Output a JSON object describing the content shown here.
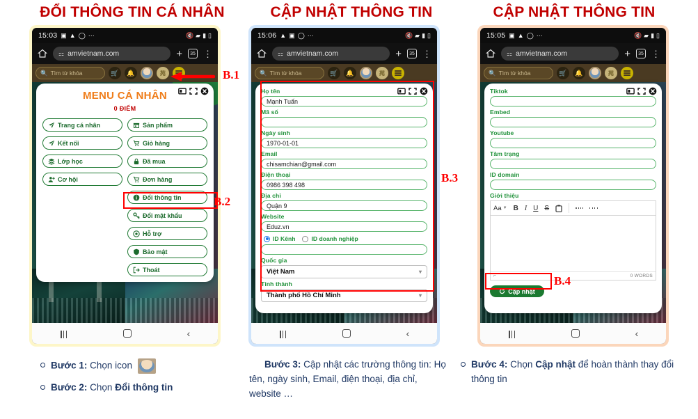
{
  "titles": {
    "col1": "ĐỔI THÔNG TIN CÁ NHÂN",
    "col2": "CẬP NHẬT THÔNG TIN",
    "col3": "CẬP NHẬT THÔNG TIN"
  },
  "step_labels": {
    "b1": "B.1",
    "b2": "B.2",
    "b3": "B.3",
    "b4": "B.4"
  },
  "phone1": {
    "status": {
      "time": "15:03",
      "dots": "···"
    },
    "browser": {
      "url": "amvietnam.com",
      "tab_count": "35"
    },
    "site": {
      "search_placeholder": "Tìm từ khóa",
      "badge": "苑"
    },
    "menu": {
      "title": "MENU CÁ NHÂN",
      "points": "0 ĐIỂM",
      "left_items": [
        {
          "label": "Trang cá nhân",
          "icon": "send-icon"
        },
        {
          "label": "Kết nối",
          "icon": "send-icon"
        },
        {
          "label": "Lớp học",
          "icon": "layers-icon"
        },
        {
          "label": "Cơ hội",
          "icon": "user-plus-icon"
        }
      ],
      "right_items": [
        {
          "label": "Sản phẩm",
          "icon": "store-icon"
        },
        {
          "label": "Giỏ hàng",
          "icon": "cart-icon"
        },
        {
          "label": "Đã mua",
          "icon": "lock-icon"
        },
        {
          "label": "Đơn hàng",
          "icon": "cart-icon"
        },
        {
          "label": "Đổi thông tin",
          "icon": "info-icon"
        },
        {
          "label": "Đổi mật khẩu",
          "icon": "key-icon"
        },
        {
          "label": "Hỗ trợ",
          "icon": "support-icon"
        },
        {
          "label": "Bảo mật",
          "icon": "shield-icon"
        },
        {
          "label": "Thoát",
          "icon": "logout-icon"
        }
      ]
    }
  },
  "phone2": {
    "status": {
      "time": "15:06",
      "dots": "···"
    },
    "browser": {
      "url": "amvietnam.com",
      "tab_count": "35"
    },
    "site": {
      "search_placeholder": "Tìm từ khóa",
      "badge": "苑"
    },
    "form": {
      "fields": [
        {
          "label": "Họ tên",
          "value": "Mạnh Tuấn"
        },
        {
          "label": "Mã số",
          "value": ""
        },
        {
          "label": "Ngày sinh",
          "value": "1970-01-01"
        },
        {
          "label": "Email",
          "value": "chisamchian@gmail.com"
        },
        {
          "label": "Điện thoại",
          "value": "0986 398 498"
        },
        {
          "label": "Địa chỉ",
          "value": "Quận 9"
        },
        {
          "label": "Website",
          "value": "Eduz.vn"
        }
      ],
      "radios": [
        {
          "label": "ID Kênh",
          "selected": true
        },
        {
          "label": "ID doanh nghiệp",
          "selected": false
        }
      ],
      "channel_value": "",
      "selects": [
        {
          "label": "Quốc gia",
          "value": "Việt Nam"
        },
        {
          "label": "Tỉnh thành",
          "value": "Thành phố Hồ Chí Minh"
        }
      ]
    }
  },
  "phone3": {
    "status": {
      "time": "15:05",
      "dots": "···"
    },
    "browser": {
      "url": "amvietnam.com",
      "tab_count": "35"
    },
    "site": {
      "search_placeholder": "Tìm từ khóa",
      "badge": "苑"
    },
    "form": {
      "fields": [
        {
          "label": "Tiktok",
          "value": ""
        },
        {
          "label": "Embed",
          "value": ""
        },
        {
          "label": "Youtube",
          "value": ""
        },
        {
          "label": "Tâm trạng",
          "value": ""
        },
        {
          "label": "ID domain",
          "value": ""
        }
      ],
      "editor_label": "Giới thiệu",
      "editor_toolbar": [
        "font-size-icon",
        "bold-icon",
        "italic-icon",
        "underline-icon",
        "strikethrough-icon",
        "paste-icon",
        "align-left-icon",
        "align-center-icon",
        "align-right-icon"
      ],
      "editor_font_label": "Aa",
      "editor_bold": "B",
      "editor_italic": "I",
      "editor_underline": "U",
      "editor_strike": "S",
      "word_count": "0 WORDS",
      "submit_label": "Cập nhật"
    }
  },
  "navbar": {
    "recent": "recent-apps-icon",
    "home": "home-icon",
    "back": "back-icon"
  },
  "captions": {
    "step1_bold": "Bước 1:",
    "step1_text": "Chọn icon",
    "step2_bold": "Bước 2:",
    "step2_text": "Chọn",
    "step2_emph": "Đổi thông tin",
    "step3_bold": "Bước 3:",
    "step3_text": "Cập nhật các trường thông tin: Họ tên, ngày sinh, Email, điện thoại, địa chỉ, website …",
    "step4_bold": "Bước 4:",
    "step4_text_a": "Chọn",
    "step4_emph": "Cập nhật",
    "step4_text_b": "để hoàn thành thay đổi thông tin"
  },
  "colors": {
    "title_red": "#c00000",
    "highlight_red": "#ff0000",
    "menu_orange": "#ef7d1a",
    "green": "#1f7a33",
    "caption_navy": "#1f3864"
  }
}
